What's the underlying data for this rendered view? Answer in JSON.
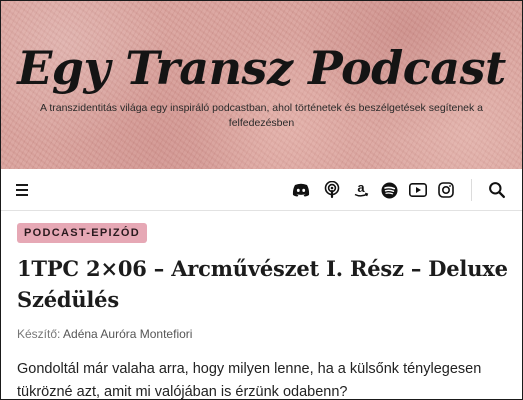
{
  "site": {
    "title": "Egy Transz Podcast",
    "tagline": "A transzidentitás világa egy inspiráló podcastban, ahol történetek és beszélgetések segítenek a felfedezésben"
  },
  "nav": {
    "menu_icon": "hamburger-menu-icon",
    "socials": [
      "discord-icon",
      "podcast-icon",
      "amazon-icon",
      "spotify-icon",
      "youtube-icon",
      "instagram-icon"
    ],
    "search_icon": "search-icon"
  },
  "post": {
    "category": "PODCAST-EPIZÓD",
    "title": "1TPC 2×06 – Arcművészet I. Rész – Deluxe Szédülés",
    "byline_label": "Készítő:",
    "author": "Adéna Auróra Montefiori",
    "excerpt": "Gondoltál már valaha arra, hogy milyen lenne, ha a külsőnk ténylegesen tükrözné azt, amit mi valójában is érzünk odabenn?"
  },
  "colors": {
    "banner": "#d9a09a",
    "badge": "#e6a8b5",
    "text": "#222222"
  }
}
